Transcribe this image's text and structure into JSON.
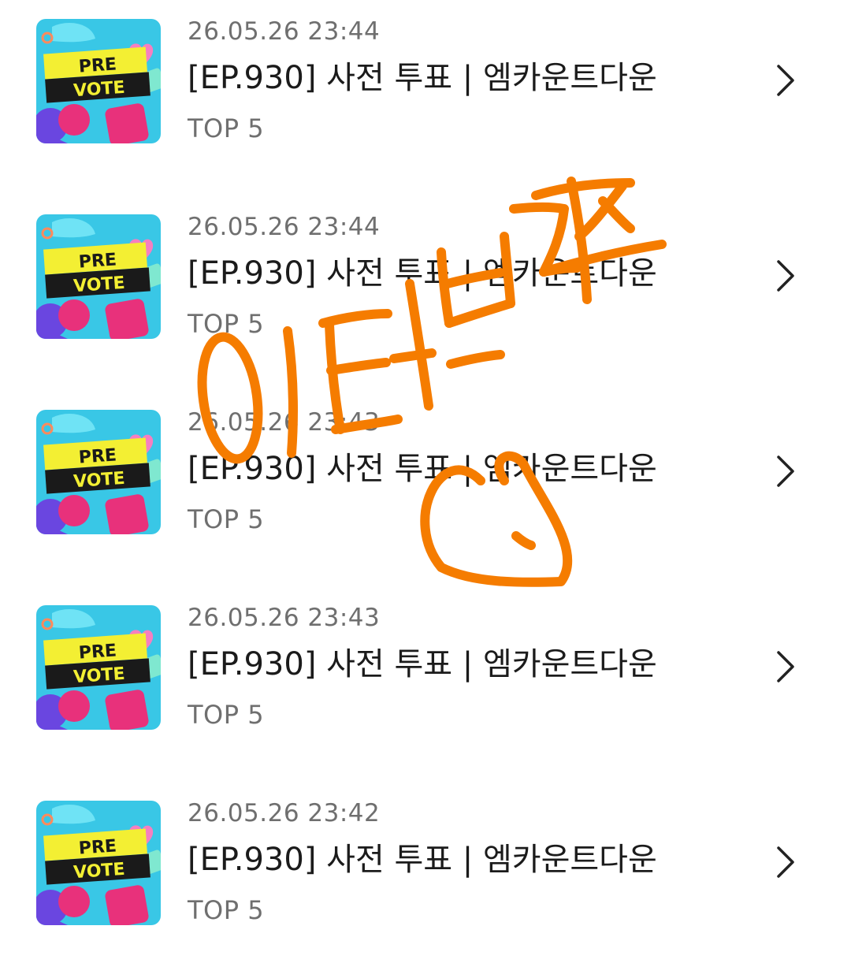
{
  "thumbnail": {
    "line1": "PRE",
    "line2": "VOTE",
    "colors": {
      "background": "#39c7e6",
      "banner": "#f3ef33",
      "banner_text": "#1a1a1a",
      "heart": "#f57fc0",
      "magenta": "#e8317b",
      "purple": "#6a46e0"
    }
  },
  "chevron_icon": "chevron-right-icon",
  "items": [
    {
      "date": "26.05.26 23:44",
      "title": "[EP.930] 사전 투표 | 엠카운트다운",
      "rank": "TOP 5"
    },
    {
      "date": "26.05.26 23:44",
      "title": "[EP.930] 사전 투표 | 엠카운트다운",
      "rank": "TOP 5"
    },
    {
      "date": "26.05.26 23:43",
      "title": "[EP.930] 사전 투표 | 엠카운트다운",
      "rank": "TOP 5"
    },
    {
      "date": "26.05.26 23:43",
      "title": "[EP.930] 사전 투표 | 엠카운트다운",
      "rank": "TOP 5"
    },
    {
      "date": "26.05.26 23:42",
      "title": "[EP.930] 사전 투표 | 엠카운트다운",
      "rank": "TOP 5"
    }
  ],
  "annotation": {
    "color": "#f57c00"
  }
}
